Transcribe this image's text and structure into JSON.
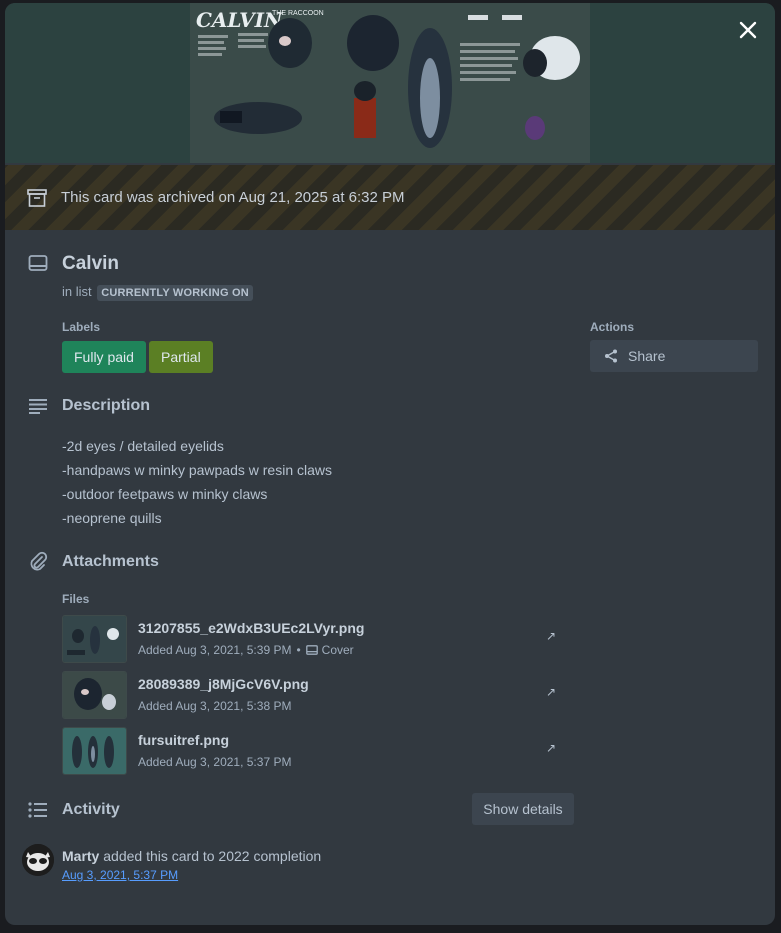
{
  "cover": {
    "art_title": "CALVIN",
    "art_subtitle": "THE RACCOON"
  },
  "archive": {
    "icon": "archive-box-icon",
    "text": "This card was archived on Aug 21, 2025 at 6:32 PM"
  },
  "card": {
    "title": "Calvin",
    "in_list_prefix": "in list",
    "list_name": "CURRENTLY WORKING ON"
  },
  "labels": {
    "heading": "Labels",
    "items": [
      {
        "text": "Fully paid",
        "color": "#1f845a"
      },
      {
        "text": "Partial",
        "color": "#5b7f24"
      }
    ]
  },
  "actions": {
    "heading": "Actions",
    "share_label": "Share"
  },
  "description": {
    "heading": "Description",
    "lines": [
      "-2d eyes / detailed eyelids",
      "-handpaws w minky pawpads w resin claws",
      "-outdoor feetpaws w minky claws",
      "-neoprene quills"
    ]
  },
  "attachments": {
    "heading": "Attachments",
    "files_heading": "Files",
    "files": [
      {
        "name": "31207855_e2WdxB3UEc2LVyr.png",
        "added": "Added Aug 3, 2021, 5:39 PM",
        "dot": "•",
        "cover": "Cover",
        "open": "↗"
      },
      {
        "name": "28089389_j8MjGcV6V.png",
        "added": "Added Aug 3, 2021, 5:38 PM",
        "open": "↗"
      },
      {
        "name": "fursuitref.png",
        "added": "Added Aug 3, 2021, 5:37 PM",
        "open": "↗"
      }
    ]
  },
  "activity": {
    "heading": "Activity",
    "show_details_label": "Show details",
    "entries": [
      {
        "user": "Marty",
        "action": "added this card to 2022 completion",
        "time": "Aug 3, 2021, 5:37 PM"
      }
    ]
  }
}
